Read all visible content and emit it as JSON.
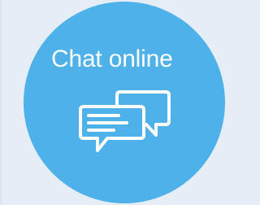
{
  "widget": {
    "label": "Chat online",
    "icon": "chat-bubbles-icon",
    "colors": {
      "circle": "#4eb1ea",
      "foreground": "#ffffff",
      "background": "#e5eef7"
    }
  }
}
